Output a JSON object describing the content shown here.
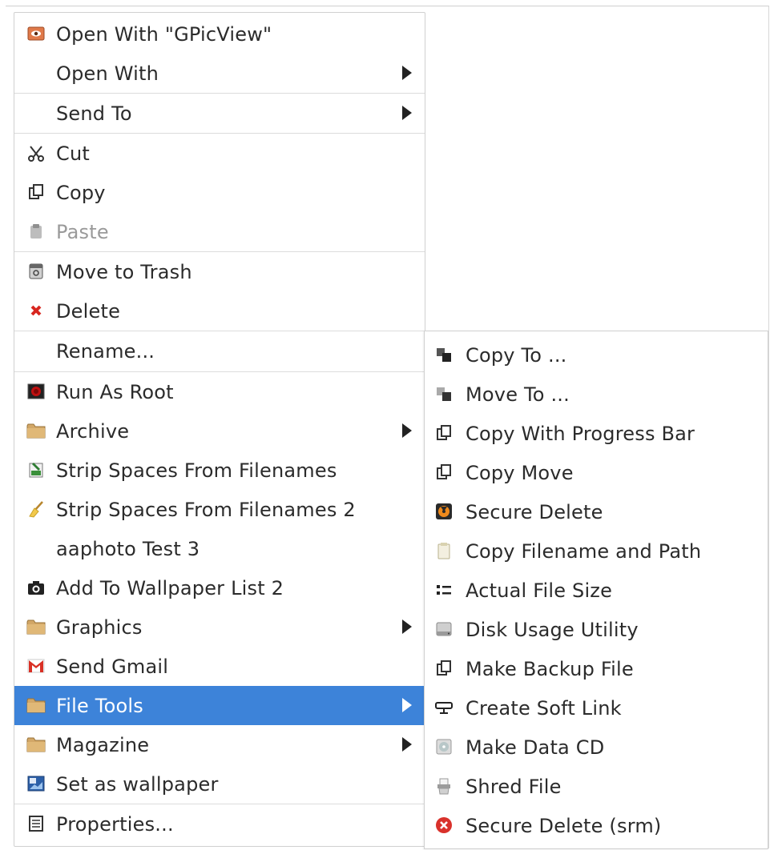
{
  "main_menu": {
    "open_with_gpicview": "Open With \"GPicView\"",
    "open_with": "Open With",
    "send_to": "Send To",
    "cut": "Cut",
    "copy": "Copy",
    "paste": "Paste",
    "move_to_trash": "Move to Trash",
    "delete": "Delete",
    "rename": "Rename...",
    "run_as_root": "Run As Root",
    "archive": "Archive",
    "strip_spaces": "Strip Spaces From Filenames",
    "strip_spaces_2": "Strip Spaces From Filenames 2",
    "aaphoto_test": "aaphoto Test 3",
    "add_to_wallpaper": "Add To Wallpaper List 2",
    "graphics": "Graphics",
    "send_gmail": "Send Gmail",
    "file_tools": "File Tools",
    "magazine": "Magazine",
    "set_as_wallpaper": "Set as wallpaper",
    "properties": "Properties..."
  },
  "submenu": {
    "copy_to": "Copy To ...",
    "move_to": "Move To ...",
    "copy_with_progress": "Copy With Progress Bar",
    "copy_move": "Copy Move",
    "secure_delete": "Secure Delete",
    "copy_filename_path": "Copy Filename and Path",
    "actual_file_size": "Actual File Size",
    "disk_usage": "Disk Usage Utility",
    "make_backup": "Make Backup File",
    "create_soft_link": "Create Soft Link",
    "make_data_cd": "Make Data CD",
    "shred_file": "Shred File",
    "secure_delete_srm": "Secure Delete (srm)"
  },
  "colors": {
    "selection": "#3d83d9",
    "separator": "#dcdcdc",
    "text": "#2b2b2b",
    "disabled_text": "#9a9a9a"
  },
  "selected_item": "File Tools"
}
